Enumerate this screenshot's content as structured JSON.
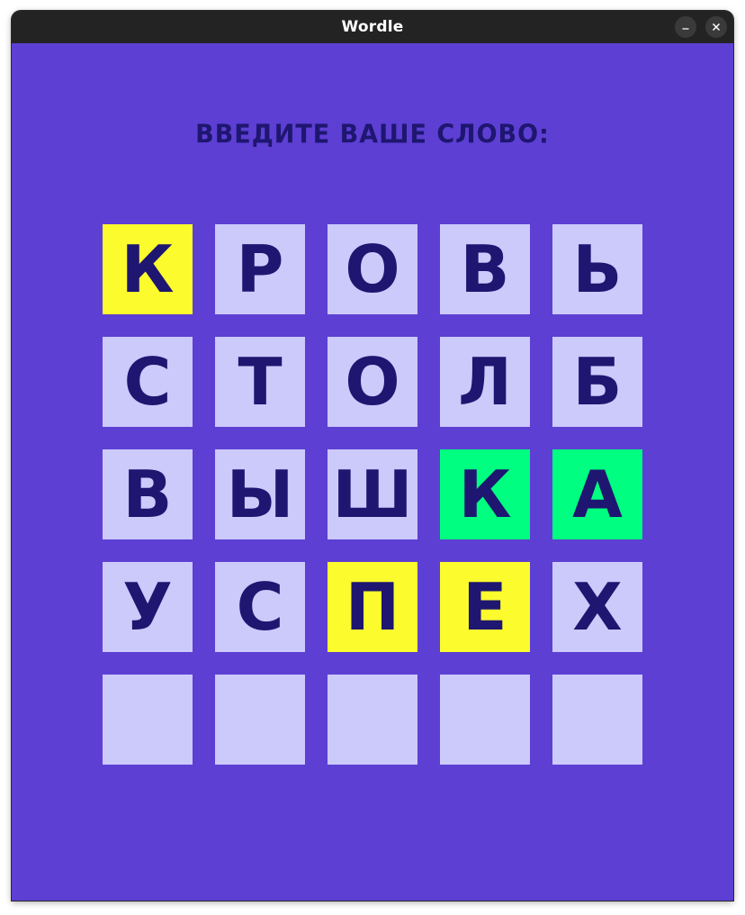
{
  "window": {
    "title": "Wordle"
  },
  "game": {
    "prompt": "ВВЕДИТЕ ВАШЕ СЛОВО:",
    "colors": {
      "background": "#5d3fd3",
      "present": "#fbfb2e",
      "correct": "#00ff80",
      "absent": "#ccc9fb",
      "letter": "#1e1670"
    },
    "rows": [
      [
        {
          "letter": "К",
          "state": "present"
        },
        {
          "letter": "Р",
          "state": "absent"
        },
        {
          "letter": "О",
          "state": "absent"
        },
        {
          "letter": "В",
          "state": "absent"
        },
        {
          "letter": "Ь",
          "state": "absent"
        }
      ],
      [
        {
          "letter": "С",
          "state": "absent"
        },
        {
          "letter": "Т",
          "state": "absent"
        },
        {
          "letter": "О",
          "state": "absent"
        },
        {
          "letter": "Л",
          "state": "absent"
        },
        {
          "letter": "Б",
          "state": "absent"
        }
      ],
      [
        {
          "letter": "В",
          "state": "absent"
        },
        {
          "letter": "Ы",
          "state": "absent"
        },
        {
          "letter": "Ш",
          "state": "absent"
        },
        {
          "letter": "К",
          "state": "correct"
        },
        {
          "letter": "А",
          "state": "correct"
        }
      ],
      [
        {
          "letter": "У",
          "state": "absent"
        },
        {
          "letter": "С",
          "state": "absent"
        },
        {
          "letter": "П",
          "state": "present"
        },
        {
          "letter": "Е",
          "state": "present"
        },
        {
          "letter": "Х",
          "state": "absent"
        }
      ],
      [
        {
          "letter": "",
          "state": "empty"
        },
        {
          "letter": "",
          "state": "empty"
        },
        {
          "letter": "",
          "state": "empty"
        },
        {
          "letter": "",
          "state": "empty"
        },
        {
          "letter": "",
          "state": "empty"
        }
      ]
    ]
  }
}
